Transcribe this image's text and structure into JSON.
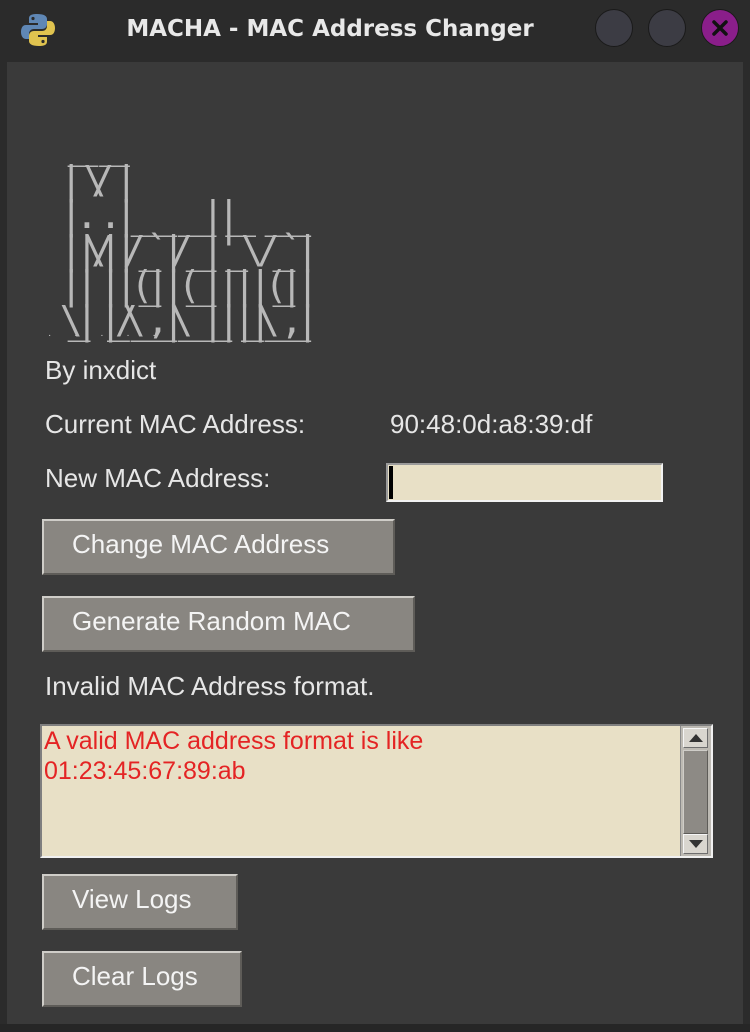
{
  "window": {
    "title": "MACHA - MAC Address Changer",
    "app_icon": "python-icon",
    "close_icon": "close-icon"
  },
  "banner": {
    "ascii_art": "   __  __    \n  |  \\/  |    \n  | .  . | __ _  ___| |__   __ _\n  | |\\/| |/ _` |/ __| '_ \\ / _` |\n  | |  | | (_| | (__| | | | (_| |\n  \\_|  |_/\\__,_|\\___|_| |_|\\__,_|",
    "author": "By inxdict"
  },
  "current_mac": {
    "label": "Current MAC Address:",
    "value": "90:48:0d:a8:39:df"
  },
  "new_mac": {
    "label": "New MAC Address:",
    "value": ""
  },
  "buttons": {
    "change": "Change MAC Address",
    "random": "Generate Random MAC",
    "view_logs": "View Logs",
    "clear_logs": "Clear Logs"
  },
  "status": {
    "message": "Invalid MAC Address format."
  },
  "log": {
    "text": "A valid MAC address format is like\n01:23:45:67:89:ab",
    "text_color": "#e42424"
  },
  "colors": {
    "background": "#3a3a3a",
    "titlebar": "#2b2b2b",
    "button": "#898681",
    "field": "#e8e0c6",
    "close_button": "#8a1e8a"
  }
}
